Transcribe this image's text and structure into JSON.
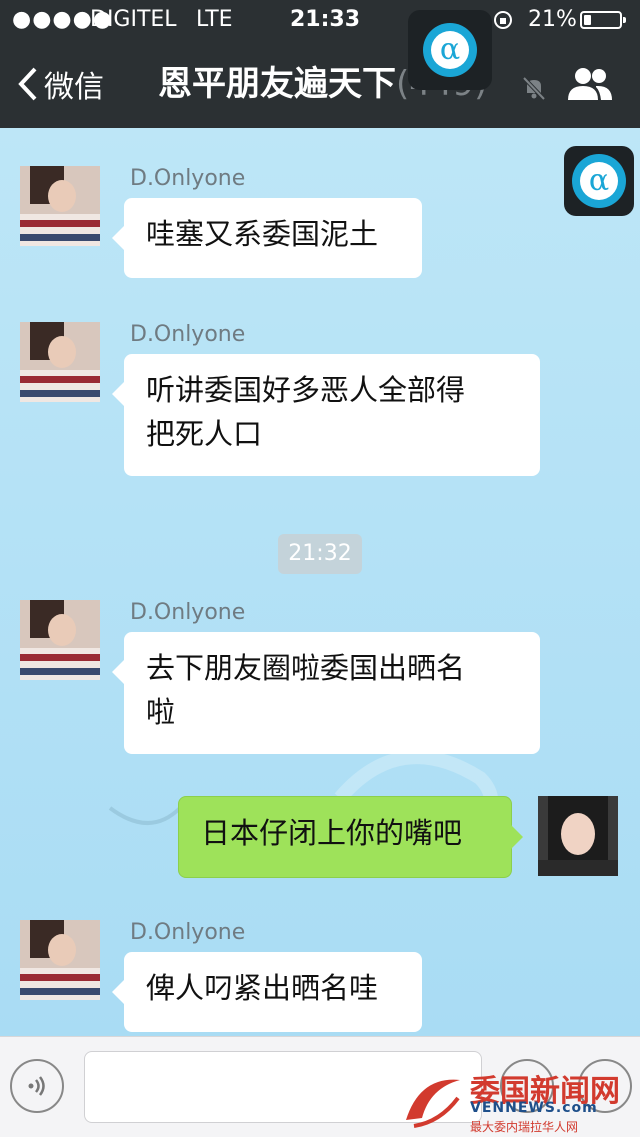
{
  "status_bar": {
    "signal": "●●●●●",
    "carrier": "DIGITEL",
    "network": "LTE",
    "time": "21:33",
    "battery_percent": "21%",
    "battery_level": 0.21
  },
  "nav": {
    "back_label": "微信",
    "title": "恩平朋友遍天下",
    "member_count": "(449)",
    "icons": [
      "chevron-left-icon",
      "mute-bell-icon",
      "members-icon"
    ]
  },
  "messages": [
    {
      "sender": "D.Onlyone",
      "direction": "in",
      "text": "哇塞又系委国泥土"
    },
    {
      "sender": "D.Onlyone",
      "direction": "in",
      "lines": [
        "听讲委国好多恶人全部得",
        "把死人口"
      ]
    },
    {
      "sender": "D.Onlyone",
      "direction": "in",
      "lines": [
        "去下朋友圈啦委国出晒名",
        "啦"
      ]
    },
    {
      "sender": "",
      "direction": "out",
      "text": "日本仔闭上你的嘴吧"
    },
    {
      "sender": "D.Onlyone",
      "direction": "in",
      "text": "俾人叼紧出晒名哇"
    }
  ],
  "timestamp": "21:32",
  "watermark": {
    "site_cn": "委国新闻网",
    "site_en": "VENNEWS.com",
    "slogan": "最大委内瑞拉华人网"
  },
  "colors": {
    "nav_bg": "#2b3033",
    "chat_bg": "#b6e2f6",
    "bubble_in": "#ffffff",
    "bubble_out": "#9ee25a",
    "accent": "#1aa6d6"
  }
}
